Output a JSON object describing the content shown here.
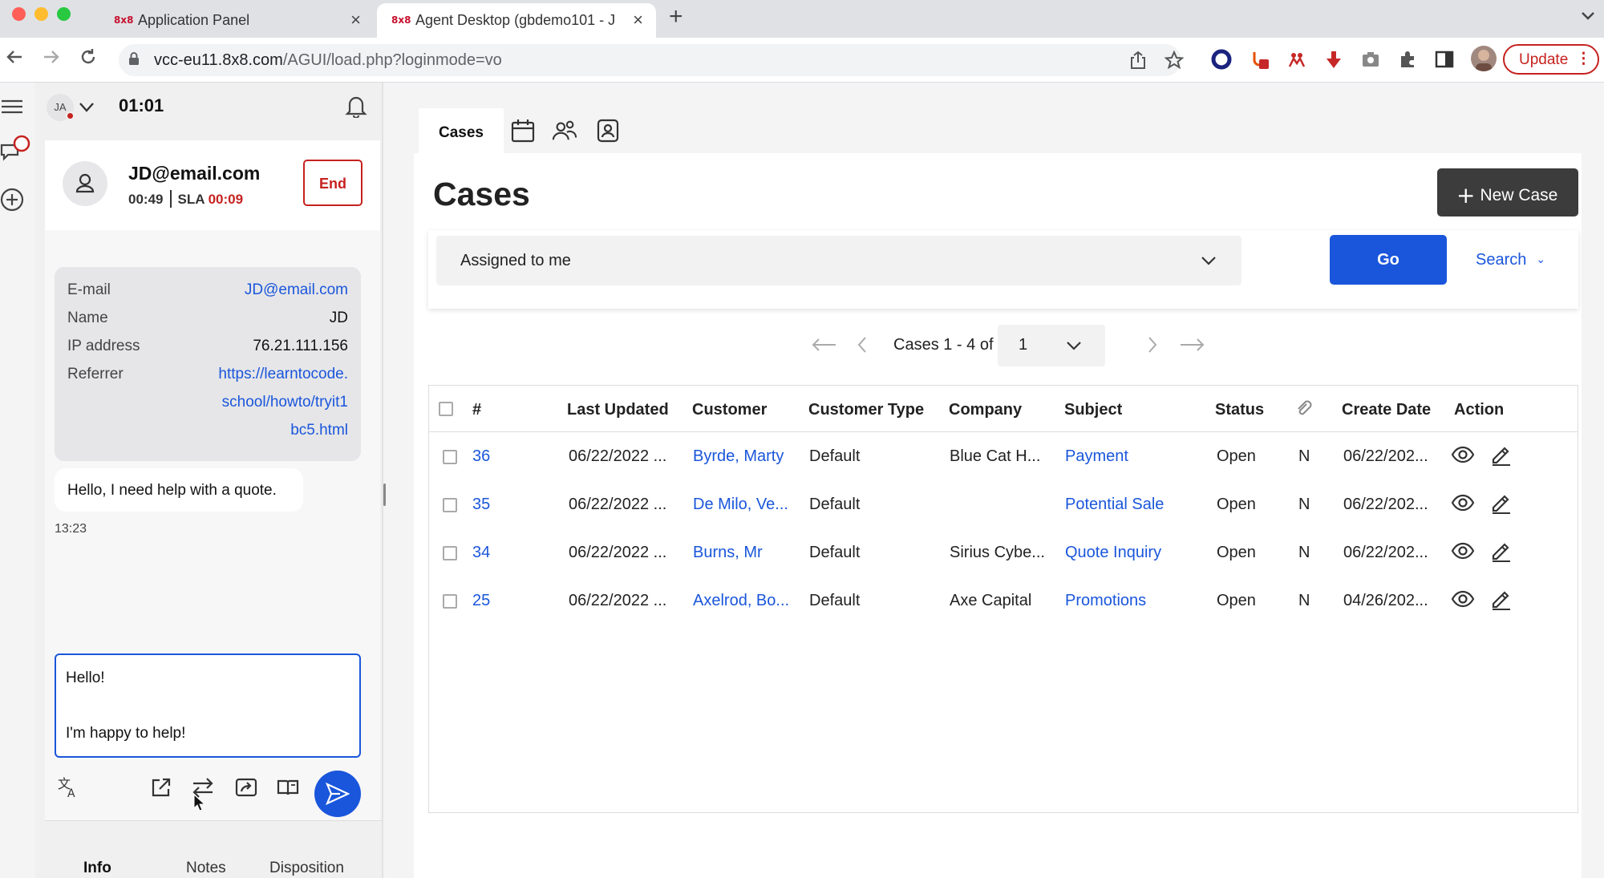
{
  "browser": {
    "tabs": [
      {
        "favicon": "8x8",
        "title": "Application Panel",
        "active": false
      },
      {
        "favicon": "8x8",
        "title": "Agent Desktop (gbdemo101 - J",
        "active": true
      }
    ],
    "url_host": "vcc-eu11.8x8.com",
    "url_path": "/AGUI/load.php?loginmode=vo",
    "update_label": "Update"
  },
  "agent": {
    "avatar_initials": "JA",
    "timer": "01:01",
    "contact": {
      "email": "JD@email.com",
      "elapsed": "00:49",
      "sla_label": "SLA",
      "sla_time": "00:09",
      "end_label": "End"
    },
    "info": [
      {
        "label": "E-mail",
        "value": "JD@email.com",
        "link": true
      },
      {
        "label": "Name",
        "value": "JD",
        "link": false
      },
      {
        "label": "IP address",
        "value": "76.21.111.156",
        "link": false
      },
      {
        "label": "Referrer",
        "value": "https://learntocode.",
        "link": true
      },
      {
        "label": "",
        "value": "school/howto/tryit1",
        "link": true
      },
      {
        "label": "",
        "value": "bc5.html",
        "link": true
      }
    ],
    "message": {
      "text": "Hello, I need help with a quote.",
      "time": "13:23"
    },
    "compose": {
      "line1": "Hello!",
      "line2": "I'm happy to help!"
    },
    "tabs": [
      "Info",
      "Notes",
      "Disposition"
    ]
  },
  "workspace": {
    "tab_cases": "Cases",
    "title": "Cases",
    "new_case_label": "New Case",
    "filter_value": "Assigned to me",
    "go_label": "Go",
    "search_label": "Search",
    "pager_text": "Cases 1 - 4 of 4",
    "page_value": "1",
    "columns": [
      "#",
      "Last Updated",
      "Customer",
      "Customer Type",
      "Company",
      "Subject",
      "Status",
      "",
      "Create Date",
      "Action"
    ],
    "rows": [
      {
        "id": "36",
        "updated": "06/22/2022 ...",
        "customer": "Byrde, Marty",
        "type": "Default",
        "company": "Blue Cat H...",
        "subject": "Payment",
        "status": "Open",
        "attach": "N",
        "created": "06/22/202..."
      },
      {
        "id": "35",
        "updated": "06/22/2022 ...",
        "customer": "De Milo, Ve...",
        "type": "Default",
        "company": "",
        "subject": "Potential Sale",
        "status": "Open",
        "attach": "N",
        "created": "06/22/202..."
      },
      {
        "id": "34",
        "updated": "06/22/2022 ...",
        "customer": "Burns, Mr",
        "type": "Default",
        "company": "Sirius Cybe...",
        "subject": "Quote Inquiry",
        "status": "Open",
        "attach": "N",
        "created": "06/22/202..."
      },
      {
        "id": "25",
        "updated": "06/22/2022 ...",
        "customer": "Axelrod, Bo...",
        "type": "Default",
        "company": "Axe Capital",
        "subject": "Promotions",
        "status": "Open",
        "attach": "N",
        "created": "04/26/202..."
      }
    ]
  },
  "colors": {
    "accent": "#1a56db",
    "danger": "#c5221f",
    "dark_button": "#3c3c3c"
  }
}
